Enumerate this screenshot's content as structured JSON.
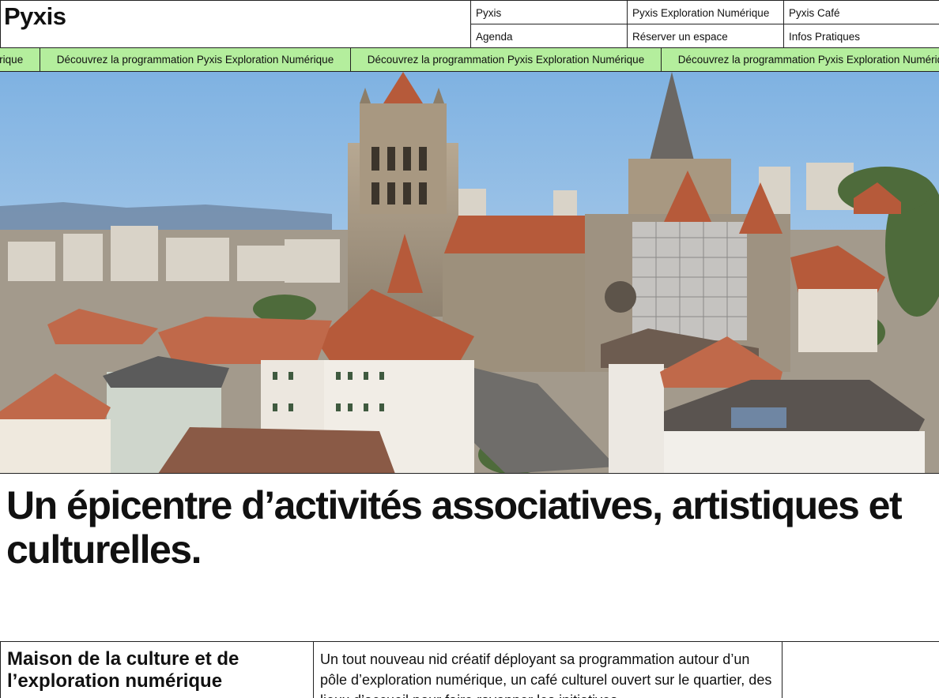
{
  "header": {
    "logo": "Pyxis",
    "nav": [
      {
        "label": "Pyxis"
      },
      {
        "label": "Pyxis Exploration Numérique"
      },
      {
        "label": "Pyxis Café"
      },
      {
        "label": "Agenda"
      },
      {
        "label": "Réserver un espace"
      },
      {
        "label": "Infos Pratiques"
      }
    ]
  },
  "ticker": {
    "label": "Découvrez la programmation Pyxis Exploration Numérique",
    "background": "#b4ee9d"
  },
  "hero": {
    "image": "lausanne-cathedral-aerial-photo",
    "sky": "#9cc3e8",
    "roof": "#b65a3a"
  },
  "headline": "Un épicentre d’activités associatives, artistiques et culturelles.",
  "intro": {
    "title": "Maison de la culture et de l’exploration numérique",
    "text": "Un tout nouveau nid créatif déployant sa programmation autour d’un pôle d’exploration numérique, un café culturel ouvert sur le quartier, des lieux d’accueil pour faire rayonner les initiatives"
  }
}
